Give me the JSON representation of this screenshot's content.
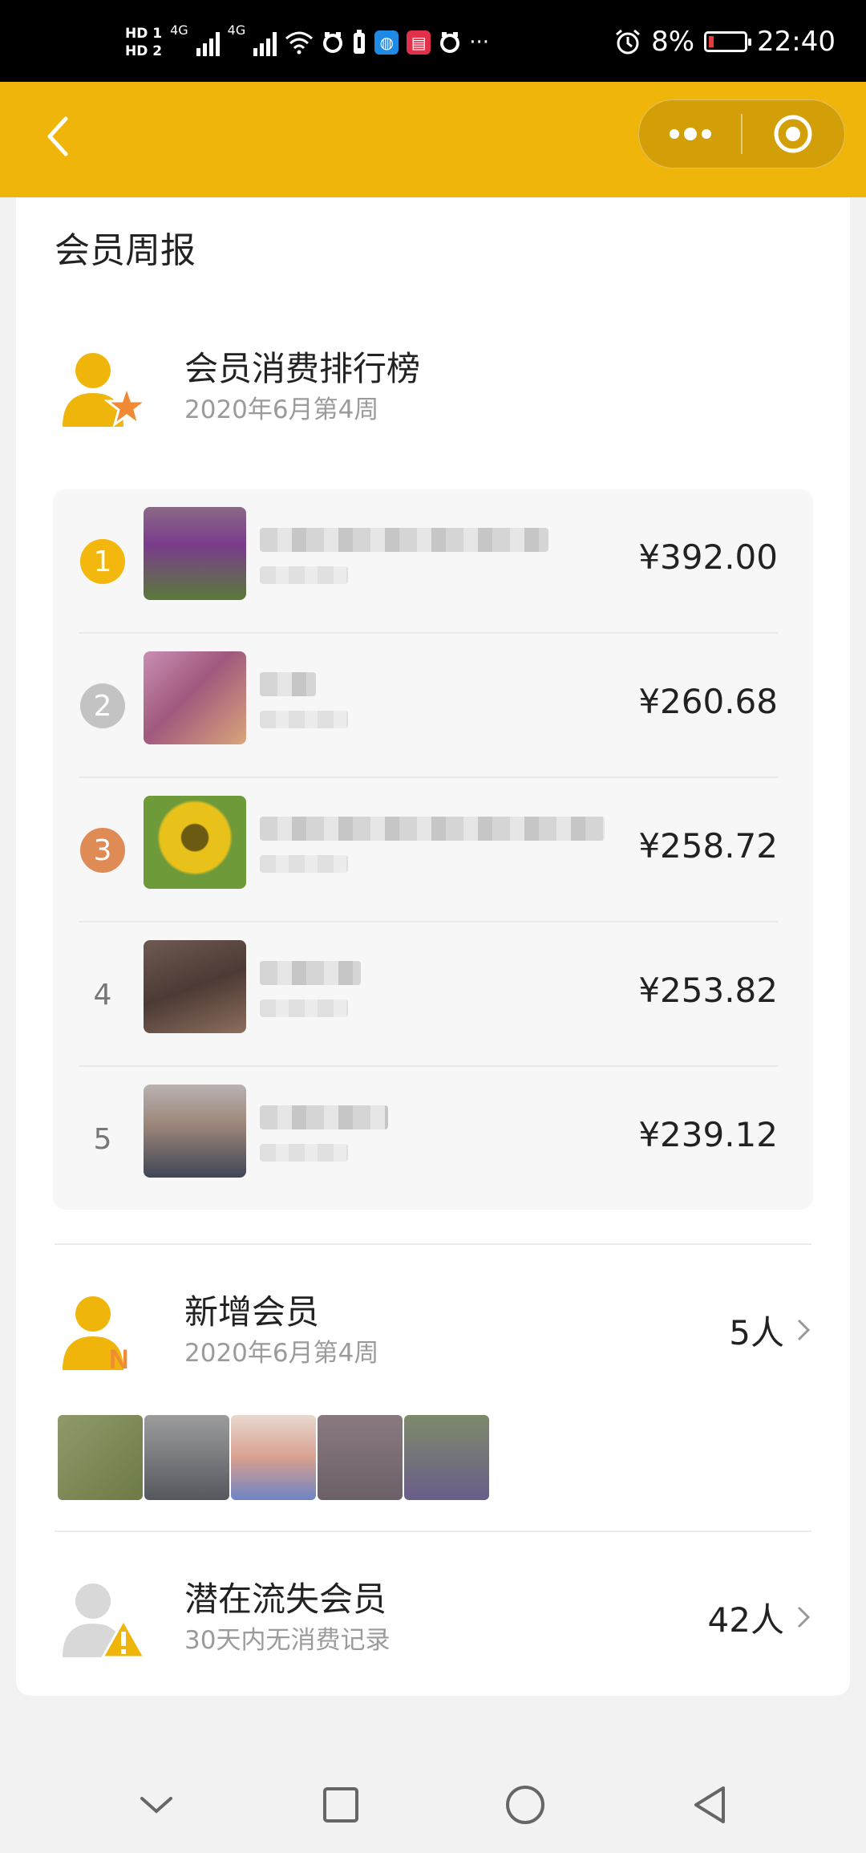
{
  "status_bar": {
    "hd1": "HD 1",
    "hd2": "HD 2",
    "net1": "4G",
    "net2": "4G",
    "more": "···",
    "battery_pct": "8%",
    "time": "22:40"
  },
  "nav": {
    "back_icon": "chevron-left-icon",
    "menu_icon": "more-dots-icon",
    "close_icon": "target-circle-icon",
    "bar_color": "#efb50b"
  },
  "page": {
    "section_title": "会员周报"
  },
  "ranking": {
    "title": "会员消费排行榜",
    "subtitle": "2020年6月第4周",
    "rows": [
      {
        "rank": "1",
        "amount": "¥392.00",
        "badge_color": "#f3b70e"
      },
      {
        "rank": "2",
        "amount": "¥260.68",
        "badge_color": "#c3c3c3"
      },
      {
        "rank": "3",
        "amount": "¥258.72",
        "badge_color": "#df8b56"
      },
      {
        "rank": "4",
        "amount": "¥253.82"
      },
      {
        "rank": "5",
        "amount": "¥239.12"
      }
    ]
  },
  "new_members": {
    "title": "新增会员",
    "subtitle": "2020年6月第4周",
    "count": "5人"
  },
  "churn_members": {
    "title": "潜在流失会员",
    "subtitle": "30天内无消费记录",
    "count": "42人"
  },
  "system_nav": {
    "icons": [
      "chevron-down-icon",
      "square-icon",
      "circle-home-icon",
      "triangle-back-icon"
    ]
  }
}
